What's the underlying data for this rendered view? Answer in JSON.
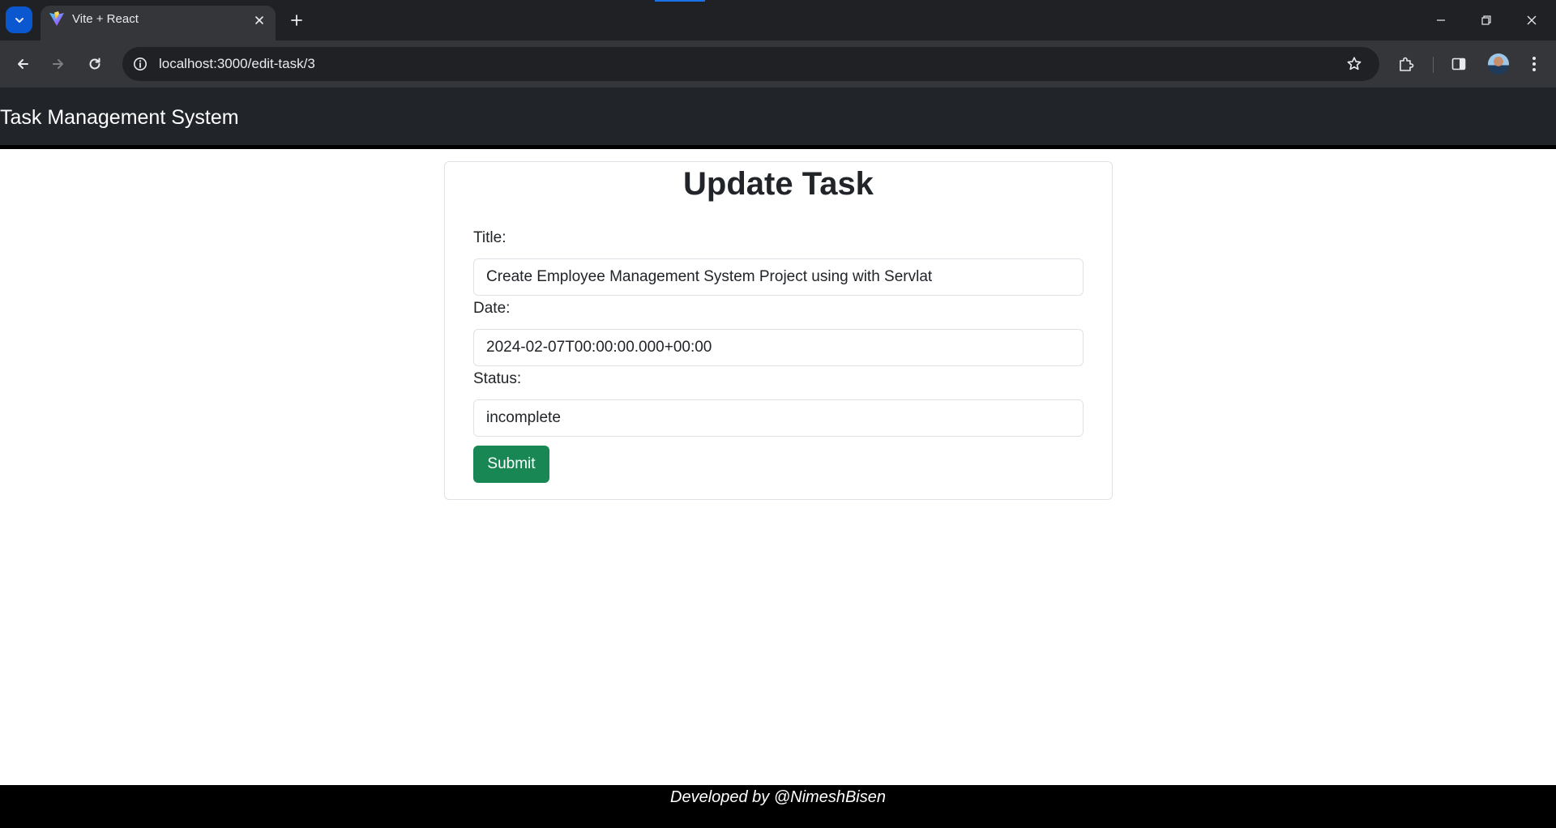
{
  "browser": {
    "tab": {
      "title": "Vite + React",
      "favicon": "vite-logo-icon"
    },
    "url": "localhost:3000/edit-task/3",
    "icons": {
      "tab_search": "chevron-down-icon",
      "new_tab": "plus-icon",
      "back": "back-arrow-icon",
      "forward": "forward-arrow-icon",
      "reload": "reload-icon",
      "site_info": "info-icon",
      "bookmark": "star-icon",
      "extensions": "puzzle-icon",
      "side_panel": "side-panel-icon",
      "menu": "kebab-menu-icon"
    },
    "accent_color": "#0b57d0"
  },
  "navbar": {
    "brand": "Task Management System",
    "background": "#212529"
  },
  "form": {
    "heading": "Update Task",
    "title_label": "Title:",
    "title_value": "Create Employee Management System Project using with Servlat",
    "date_label": "Date:",
    "date_value": "2024-02-07T00:00:00.000+00:00",
    "status_label": "Status:",
    "status_value": "incomplete",
    "submit_label": "Submit",
    "submit_color": "#198754"
  },
  "footer": {
    "text": "Developed by @NimeshBisen"
  }
}
